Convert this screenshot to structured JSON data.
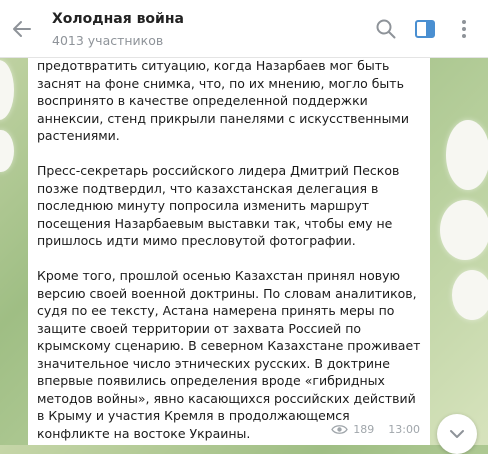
{
  "header": {
    "title": "Холодная война",
    "subtitle": "4013 участников",
    "icons": [
      "back-arrow-icon",
      "search-icon",
      "sidebar-toggle-icon",
      "more-vertical-icon"
    ]
  },
  "message": {
    "paragraphs": [
      "предотвратить ситуацию, когда Назарбаев мог быть заснят на фоне снимка, что, по их мнению, могло быть воспринято в качестве определенной поддержки аннексии, стенд прикрыли панелями с искусственными растениями.",
      "Пресс-секретарь российского лидера Дмитрий Песков позже подтвердил, что казахстанская делегация в последнюю минуту попросила изменить маршрут посещения Назарбаевым выставки так, чтобы ему не пришлось идти мимо пресловутой фотографии.",
      "Кроме того, прошлой осенью Казахстан принял новую версию своей военной доктрины. По словам аналитиков, судя по ее тексту, Астана намерена принять меры по защите своей территории от захвата Россией по крымскому сценарию. В северном Казахстане проживает значительное число этнических русских. В доктрине впервые появились определения вроде «гибридных методов войны», явно касающихся российских действий в Крыму и участия Кремля в продолжающемся конфликте на востоке Украины."
    ],
    "views": "189",
    "time": "13:00"
  },
  "colors": {
    "accent": "#4a8fd1",
    "icon_gray": "#8e9399",
    "meta_gray": "#a0a6ab"
  }
}
